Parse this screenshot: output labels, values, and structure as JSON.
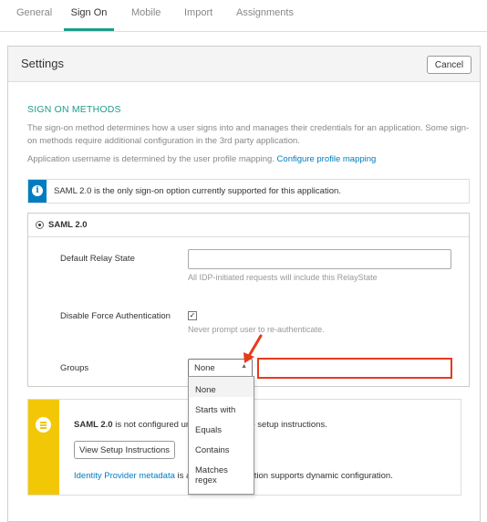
{
  "tabs": [
    {
      "label": "General",
      "active": false
    },
    {
      "label": "Sign On",
      "active": true
    },
    {
      "label": "Mobile",
      "active": false
    },
    {
      "label": "Import",
      "active": false
    },
    {
      "label": "Assignments",
      "active": false
    }
  ],
  "settings": {
    "title": "Settings",
    "cancel_label": "Cancel"
  },
  "sign_on": {
    "section_title": "SIGN ON METHODS",
    "description_line1": "The sign-on method determines how a user signs into and manages their credentials for an application. Some sign-",
    "description_line2": "on methods require additional configuration in the 3rd party application.",
    "username_text": "Application username is determined by the user profile mapping.",
    "profile_link": "Configure profile mapping",
    "info_text": "SAML 2.0 is the only sign-on option currently supported for this application.",
    "saml_label": "SAML 2.0",
    "relay_state_label": "Default Relay State",
    "relay_state_value": "",
    "relay_state_hint": "All IDP-initiated requests will include this RelayState",
    "force_auth_label": "Disable Force Authentication",
    "force_auth_checked": true,
    "force_auth_hint": "Never prompt user to re-authenticate.",
    "groups_label": "Groups",
    "groups_selected": "None",
    "groups_options": [
      "None",
      "Starts with",
      "Equals",
      "Contains",
      "Matches",
      "regex"
    ],
    "groups_filter_value": ""
  },
  "warning": {
    "bold": "SAML 2.0",
    "text_left": "is not configured unt",
    "text_right": "he setup instructions.",
    "button_label": "View Setup Instructions",
    "link": "Identity Provider metadata",
    "text2_left": "is a",
    "text2_right": "ication supports dynamic configuration."
  },
  "colors": {
    "accent": "#1e9d8b",
    "link": "#007dc1",
    "info": "#007dc1",
    "warning": "#f2c705",
    "highlight": "#e8391c"
  },
  "icons": {
    "info": "info-circle-icon",
    "warning": "list-icon",
    "caret": "caret-up-icon",
    "annotation": "red-arrow-annotation"
  }
}
